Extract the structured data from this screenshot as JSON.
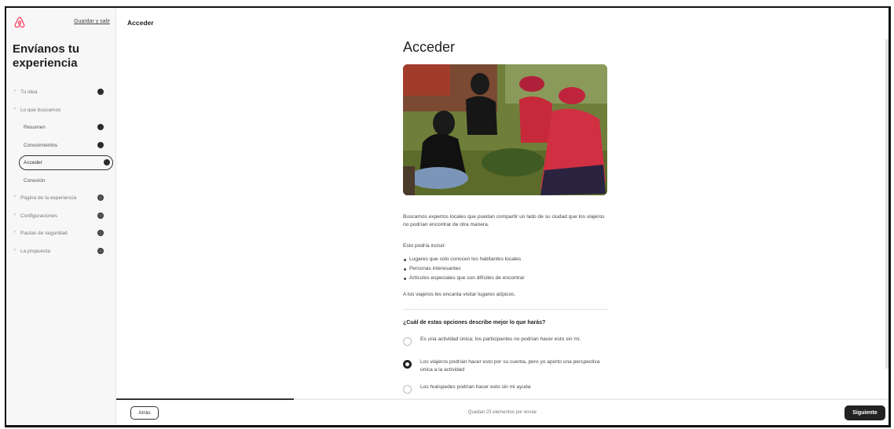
{
  "sidebar": {
    "save_label": "Guardar y salir",
    "title": "Envíanos tu experiencia",
    "items": [
      {
        "label": "Tu idea",
        "level": "top",
        "chevron": true,
        "status": "done"
      },
      {
        "label": "Lo que buscamos",
        "level": "top",
        "chevron": true,
        "status": "none"
      },
      {
        "label": "Resumen",
        "level": "sub",
        "status": "done"
      },
      {
        "label": "Conocimientos",
        "level": "sub",
        "status": "done"
      },
      {
        "label": "Acceder",
        "level": "sub",
        "status": "done",
        "active": true
      },
      {
        "label": "Conexión",
        "level": "sub",
        "status": "none"
      },
      {
        "label": "Página de la experiencia",
        "level": "top",
        "chevron": true,
        "status": "partial"
      },
      {
        "label": "Configuraciones",
        "level": "top",
        "chevron": true,
        "status": "partial"
      },
      {
        "label": "Pautas de seguridad",
        "level": "top",
        "chevron": true,
        "status": "partial"
      },
      {
        "label": "La propuesta",
        "level": "top",
        "chevron": true,
        "status": "partial"
      }
    ]
  },
  "header": {
    "title": "Acceder"
  },
  "main": {
    "heading": "Acceder",
    "intro": "Buscamos expertos locales que puedan compartir un lado de su ciudad que los viajeros no podrían encontrar de otra manera.",
    "may_include": "Esto podría incluir:",
    "bullets": [
      "Lugares que solo conocen los habitantes locales",
      "Personas interesantes",
      "Artículos especiales que son difíciles de encontrar"
    ],
    "closing": "A los viajeros les encanta visitar lugares atípicos.",
    "question": "¿Cuál de estas opciones describe mejor lo que harás?",
    "options": [
      {
        "label": "Es una actividad única; los participantes no podrían hacer esto sin mí.",
        "selected": false
      },
      {
        "label": "Los viajeros podrían hacer esto por su cuenta, pero yo aporto una perspectiva única a la actividad",
        "selected": true
      },
      {
        "label": "Los huéspedes podrían hacer esto sin mi ayuda",
        "selected": false
      }
    ]
  },
  "footer": {
    "back_label": "Atrás",
    "remaining": "Quedan 23 elementos por enviar",
    "next_label": "Siguiente",
    "progress": 0.23
  },
  "colors": {
    "brand": "#ff385c",
    "dark": "#222222"
  }
}
